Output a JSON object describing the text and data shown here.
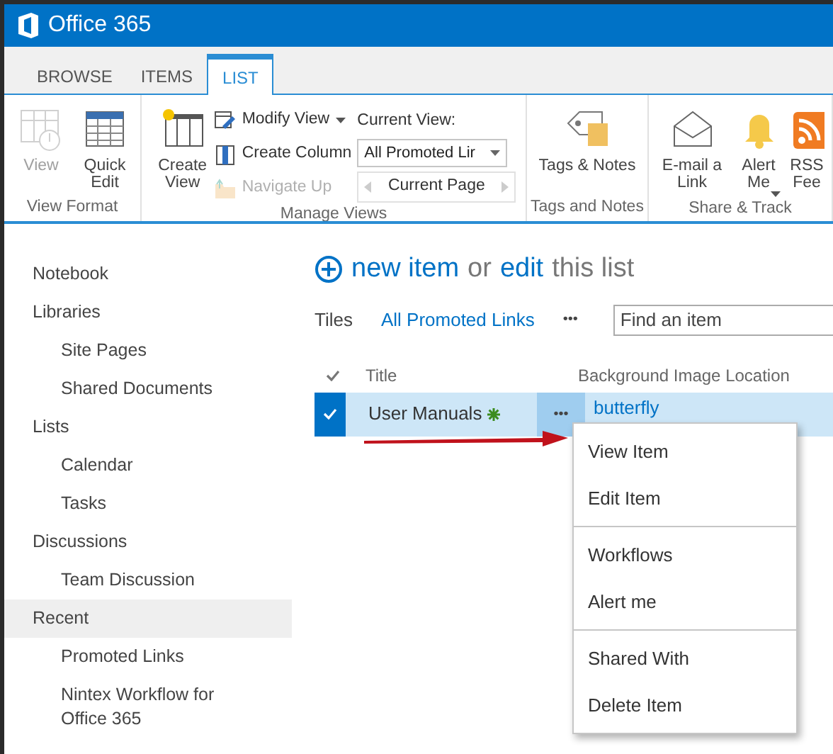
{
  "app": {
    "title": "Office 365"
  },
  "ribbon_tabs": [
    {
      "label": "BROWSE",
      "selected": false
    },
    {
      "label": "ITEMS",
      "selected": false
    },
    {
      "label": "LIST",
      "selected": true
    }
  ],
  "ribbon_groups": [
    {
      "label": "View Format",
      "buttons": [
        {
          "kind": "view",
          "label": "View",
          "disabled": true,
          "dropdown": false
        },
        {
          "kind": "quick-edit",
          "label": "Quick Edit",
          "disabled": false,
          "dropdown": false
        }
      ]
    },
    {
      "label": "Manage Views",
      "buttons": [
        {
          "kind": "create-view",
          "label": "Create View",
          "disabled": false,
          "dropdown": false
        }
      ],
      "small_buttons": [
        {
          "kind": "modify",
          "label": "Modify View",
          "disabled": false,
          "dropdown": true
        },
        {
          "kind": "column",
          "label": "Create Column",
          "disabled": false,
          "dropdown": false
        },
        {
          "kind": "navigate",
          "label": "Navigate Up",
          "disabled": true,
          "dropdown": false
        }
      ],
      "current_view": {
        "label": "Current View:",
        "value": "All Promoted Lir",
        "pager": "Current Page"
      }
    },
    {
      "label": "Tags and Notes",
      "buttons": [
        {
          "kind": "tag",
          "label": "Tags & Notes",
          "disabled": false,
          "dropdown": false
        }
      ]
    },
    {
      "label": "Share & Track",
      "buttons": [
        {
          "kind": "email",
          "label": "E-mail a Link",
          "disabled": false,
          "dropdown": false
        },
        {
          "kind": "alert",
          "label": "Alert Me",
          "disabled": false,
          "dropdown": true
        },
        {
          "kind": "rss",
          "label": "RSS Fee",
          "disabled": false,
          "dropdown": false
        }
      ]
    }
  ],
  "sidebar": {
    "items": [
      {
        "label": "Notebook",
        "selected": false
      },
      {
        "label": "Libraries",
        "selected": false,
        "children": [
          {
            "label": "Site Pages"
          },
          {
            "label": "Shared Documents"
          }
        ]
      },
      {
        "label": "Lists",
        "selected": false,
        "children": [
          {
            "label": "Calendar"
          },
          {
            "label": "Tasks"
          }
        ]
      },
      {
        "label": "Discussions",
        "selected": false,
        "children": [
          {
            "label": "Team Discussion"
          }
        ]
      },
      {
        "label": "Recent",
        "selected": true,
        "children": [
          {
            "label": "Promoted Links"
          },
          {
            "label": "Nintex Workflow for Office 365"
          }
        ]
      }
    ]
  },
  "heading": {
    "new_item": "new item",
    "or": "or",
    "edit": "edit",
    "rest": "this list"
  },
  "views": [
    {
      "label": "Tiles",
      "selected": false
    },
    {
      "label": "All Promoted Links",
      "selected": true
    }
  ],
  "more": "•••",
  "search": {
    "placeholder": "Find an item"
  },
  "table": {
    "columns": [
      "Title",
      "Background Image Location"
    ],
    "rows": [
      {
        "title": "User Manuals",
        "new": true,
        "location": "butterfly",
        "selected": true
      }
    ]
  },
  "context_menu": {
    "groups": [
      [
        "View Item",
        "Edit Item"
      ],
      [
        "Workflows",
        "Alert me"
      ],
      [
        "Shared With",
        "Delete Item"
      ]
    ]
  }
}
